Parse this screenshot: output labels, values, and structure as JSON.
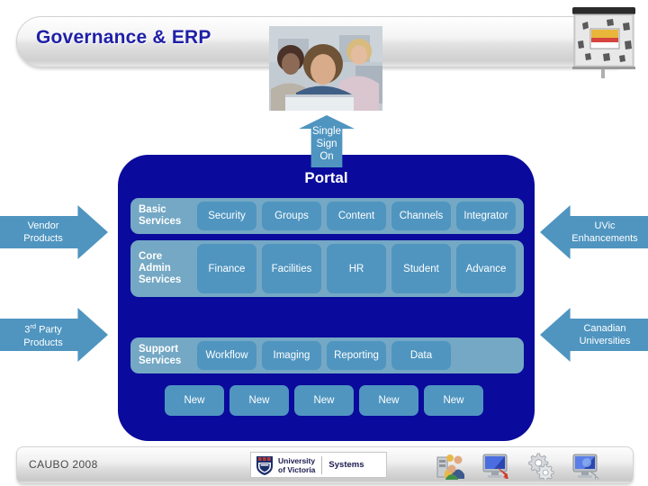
{
  "slide": {
    "title": "Governance & ERP",
    "header_photo_alt": "students-at-computers-photo",
    "screen_icon_alt": "projection-screen-icon"
  },
  "sso": {
    "line1": "Single",
    "line2": "Sign",
    "line3": "On"
  },
  "portal": {
    "title": "Portal",
    "rows": [
      {
        "label_line1": "Basic",
        "label_line2": "Services",
        "label_line3": "",
        "items": [
          "Security",
          "Groups",
          "Content",
          "Channels",
          "Integrator"
        ]
      },
      {
        "label_line1": "Core",
        "label_line2": "Admin",
        "label_line3": "Services",
        "items": [
          "Finance",
          "Facilities",
          "HR",
          "Student",
          "Advance"
        ]
      },
      {
        "label_line1": "Support",
        "label_line2": "Services",
        "label_line3": "",
        "items": [
          "Workflow",
          "Imaging",
          "Reporting",
          "Data"
        ]
      }
    ],
    "new_items": [
      "New",
      "New",
      "New",
      "New",
      "New"
    ]
  },
  "arrows": {
    "left": [
      {
        "line1": "Vendor",
        "line2": "Products",
        "sup": ""
      },
      {
        "line1": "3",
        "sup": "rd",
        "line1b": " Party",
        "line2": "Products"
      }
    ],
    "right": [
      {
        "line1": "UVic",
        "line2": "Enhancements"
      },
      {
        "line1": "Canadian",
        "line2": "Universities"
      }
    ]
  },
  "footer": {
    "conference": "CAUBO 2008",
    "logo_name_line1": "University",
    "logo_name_line2": "of Victoria",
    "logo_unit": "Systems",
    "icons": [
      "users-group-icon",
      "monitor-arrow-icon",
      "gears-icon",
      "monitor-network-icon"
    ]
  },
  "colors": {
    "panel_navy": "#0a0a9c",
    "row_band": "#74a8c4",
    "chip_blue": "#4f95c0",
    "title_navy": "#1f1fa8"
  }
}
